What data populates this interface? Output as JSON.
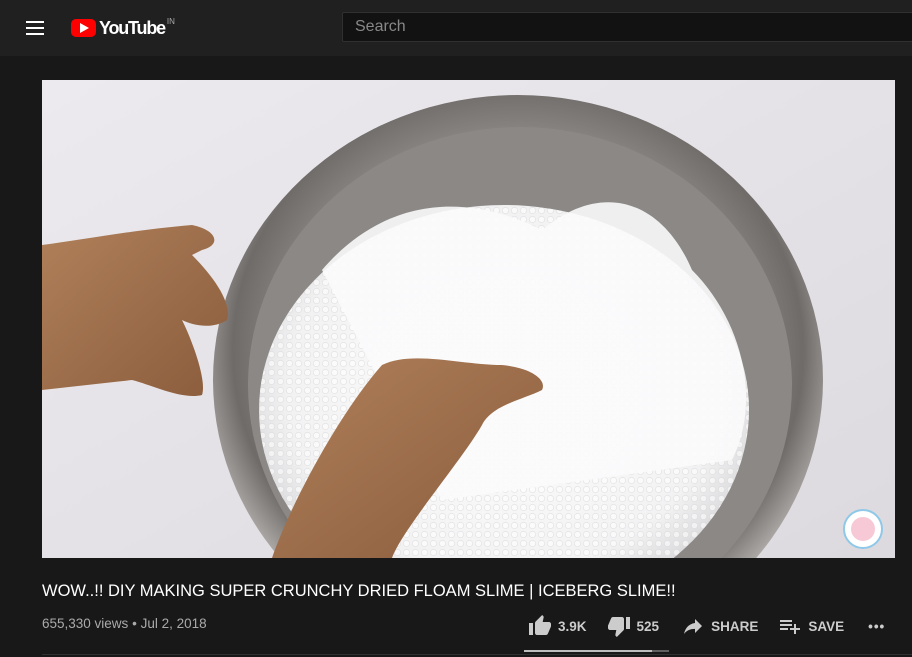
{
  "header": {
    "logo_text": "YouTube",
    "country_code": "IN",
    "search_placeholder": "Search"
  },
  "video": {
    "title": "WOW..!! DIY MAKING SUPER CRUNCHY DRIED FLOAM SLIME | ICEBERG SLIME!!",
    "views": "655,330 views",
    "separator": "•",
    "date": "Jul 2, 2018",
    "likes": "3.9K",
    "dislikes": "525",
    "like_ratio": 0.88,
    "share_label": "SHARE",
    "save_label": "SAVE",
    "more_label": "•••",
    "thumbnail_icons": [
      "steel-bowl",
      "foam-beads",
      "hand",
      "channel-watermark"
    ]
  },
  "colors": {
    "background": "#181818",
    "header": "#202020",
    "brand_red": "#ff0000",
    "text_secondary": "#aaaaaa"
  }
}
